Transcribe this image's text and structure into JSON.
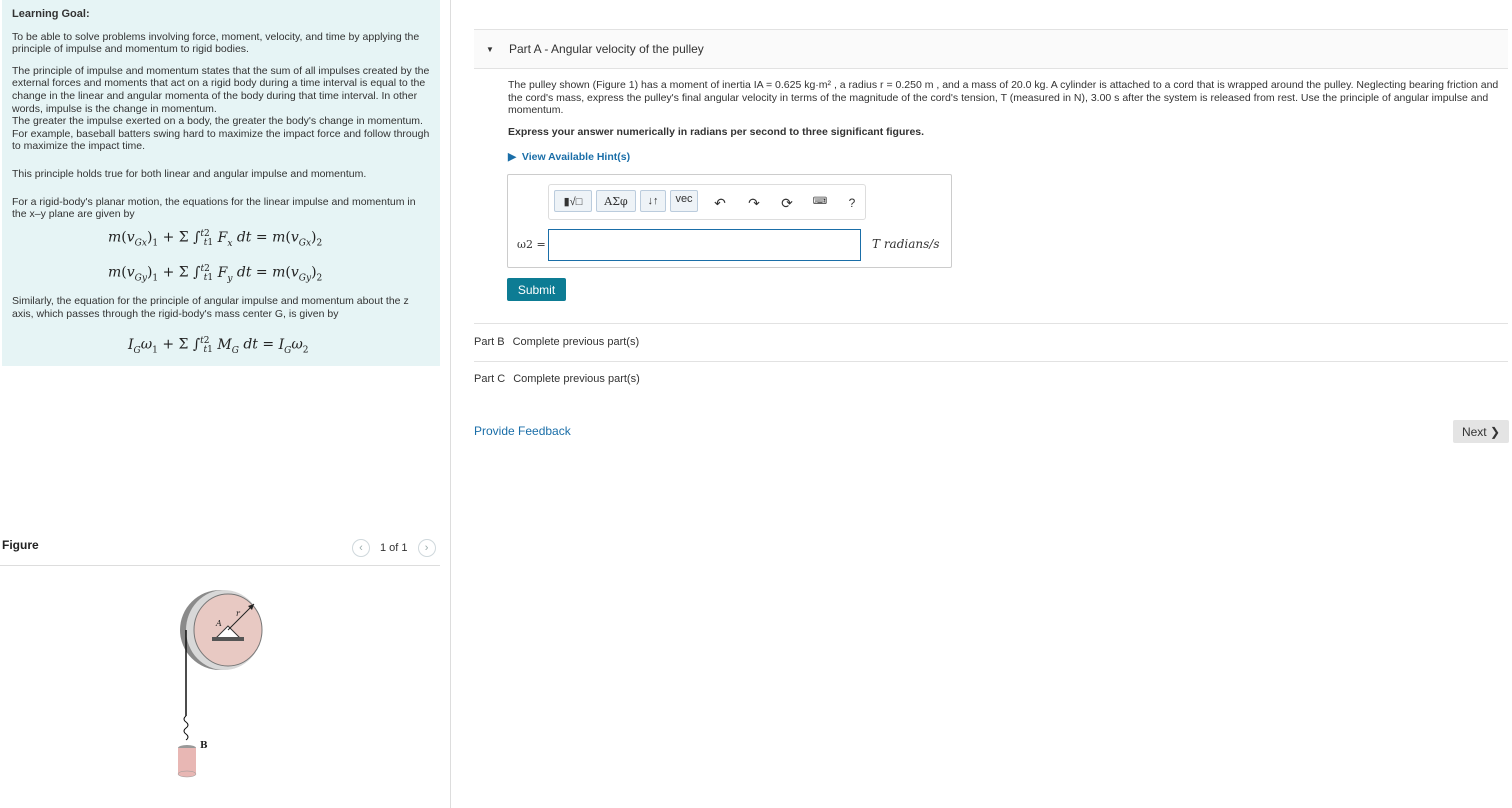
{
  "learning_goal": {
    "heading": "Learning Goal:",
    "p1": "To be able to solve problems involving force, moment, velocity, and time by applying the principle of impulse and momentum to rigid bodies.",
    "p2": "The principle of impulse and momentum states that the sum of all impulses created by the external forces and moments that act on a rigid body during a time interval is equal to the change in the linear and angular momenta of the body during that time interval. In other words, impulse is the change in momentum.",
    "p3": "The greater the impulse exerted on a body, the greater the body's change in momentum. For example, baseball batters swing hard to maximize the impact force and follow through to maximize the impact time.",
    "p4": "This principle holds true for both linear and angular impulse and momentum.",
    "p5": "For a rigid-body's planar motion, the equations for the linear impulse and momentum in the x–y plane are given by",
    "p6": "Similarly, the equation for the principle of angular impulse and momentum about the z axis, which passes through the rigid-body's mass center G, is given by",
    "eq1": "m(vGx)1 + Σ ∫t1t2 Fx dt = m(vGx)2",
    "eq2": "m(vGy)1 + Σ ∫t1t2 Fy dt = m(vGy)2",
    "eq3": "IGω1 + Σ ∫t1t2 MG dt = IGω2"
  },
  "figure": {
    "label": "Figure",
    "counter": "1 of 1",
    "prev_icon": "chevron-left-icon",
    "next_icon": "chevron-right-icon",
    "point_label": "B"
  },
  "partA": {
    "prefix": "Part A",
    "title": " - Angular velocity of the pulley",
    "problem": "The pulley shown (Figure 1) has a moment of inertia IA = 0.625 kg·m² , a radius r = 0.250 m , and a mass of 20.0 kg. A cylinder is attached to a cord that is wrapped around the pulley. Neglecting bearing friction and the cord's mass, express the pulley's final angular velocity in terms of the magnitude of the cord's tension, T (measured in N), 3.00 s after the system is released from rest. Use the principle of angular impulse and momentum.",
    "figure_link": "Figure 1",
    "instruction": "Express your answer numerically in radians per second to three significant figures.",
    "hints": "View Available Hint(s)",
    "toolbar": {
      "templates": "▮√□",
      "greek": "AΣφ",
      "arrows": "↓↑",
      "vec": "vec",
      "help": "?"
    },
    "answer_label": "ω2 =",
    "answer_value": "",
    "units": "T radians/s",
    "submit": "Submit"
  },
  "partB": {
    "prefix": "Part B",
    "status": "Complete previous part(s)"
  },
  "partC": {
    "prefix": "Part C",
    "status": "Complete previous part(s)"
  },
  "feedback": "Provide Feedback",
  "next": "Next ❯"
}
